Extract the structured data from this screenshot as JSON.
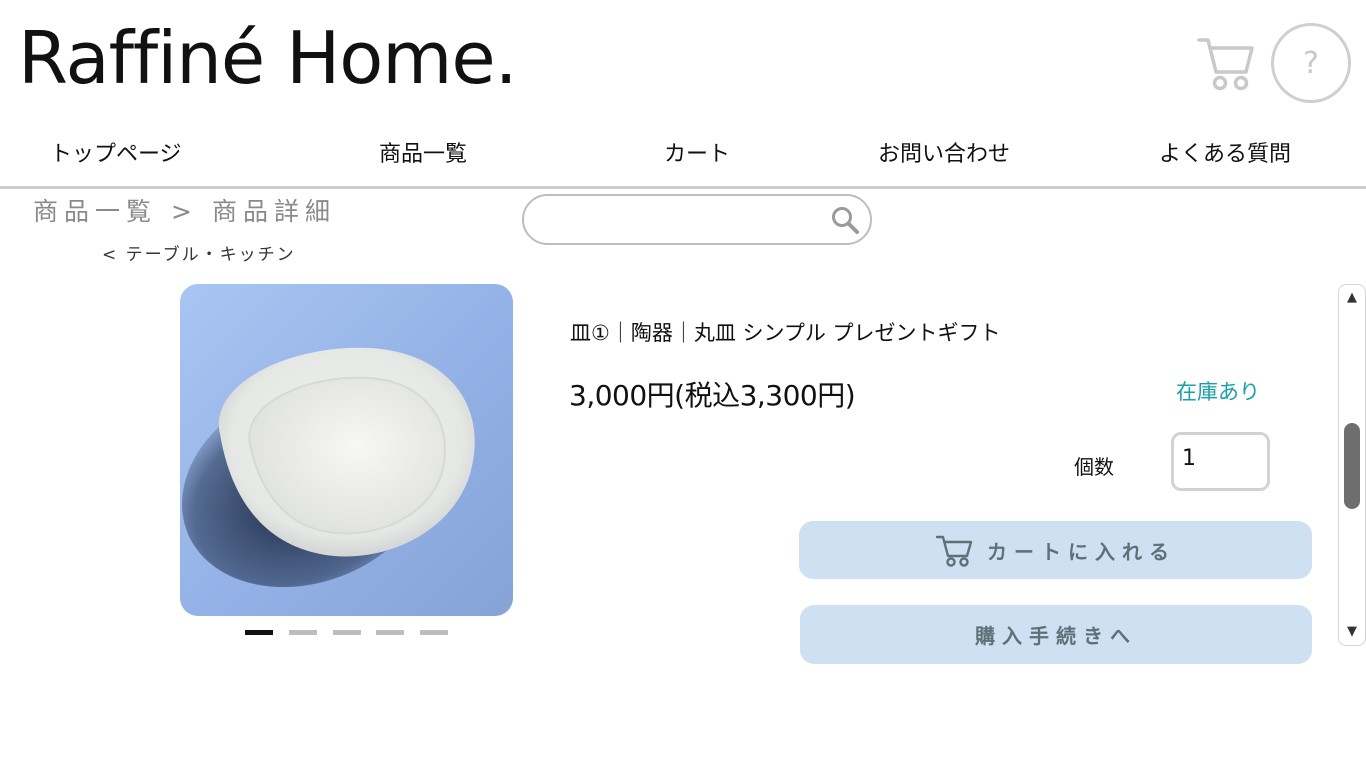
{
  "brand": {
    "name": "Raffiné Home."
  },
  "header": {
    "cart_icon": "cart-icon",
    "help_label": "?"
  },
  "nav": {
    "items": [
      {
        "label": "トップページ"
      },
      {
        "label": "商品一覧"
      },
      {
        "label": "カート"
      },
      {
        "label": "お問い合わせ"
      },
      {
        "label": "よくある質問"
      }
    ]
  },
  "breadcrumb": {
    "parent": "商品一覧",
    "separator": ">",
    "current": "商品詳細"
  },
  "category_link": "< テーブル・キッチン",
  "search": {
    "value": "",
    "placeholder": "",
    "icon": "search-icon"
  },
  "product": {
    "title": "皿①｜陶器｜丸皿 シンプル プレゼントギフト",
    "price": "3,000円(税込3,300円)",
    "stock_status": "在庫あり",
    "stock_color": "#1aa0a8",
    "quantity_label": "個数",
    "quantity_value": "1",
    "image_count": 5,
    "active_image_index": 0
  },
  "actions": {
    "add_to_cart": "カートに入れる",
    "checkout": "購入手続きへ",
    "button_color": "#cfe0f2"
  },
  "scrollbar": {
    "up_glyph": "▲",
    "down_glyph": "▼"
  }
}
